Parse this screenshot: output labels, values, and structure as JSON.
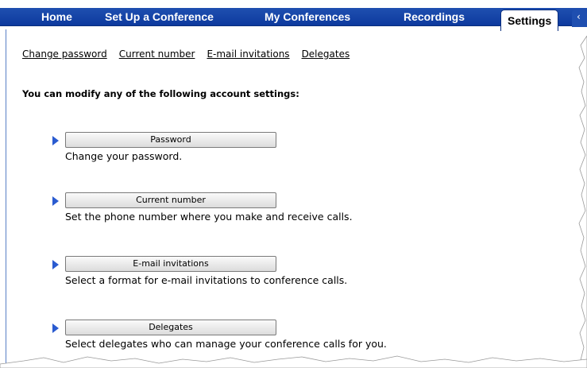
{
  "nav": {
    "tabs": [
      {
        "label": "Home"
      },
      {
        "label": "Set Up a Conference"
      },
      {
        "label": "My Conferences"
      },
      {
        "label": "Recordings"
      },
      {
        "label": "Settings"
      }
    ],
    "partial_tab_glyph": "‹",
    "accent": "#1f4fb0"
  },
  "sublinks": [
    "Change password",
    "Current number",
    "E-mail invitations",
    "Delegates"
  ],
  "intro": "You can modify any of the following account settings:",
  "items": [
    {
      "button": "Password",
      "desc": "Change your password."
    },
    {
      "button": "Current number",
      "desc": "Set the phone number where you make and receive calls."
    },
    {
      "button": "E-mail invitations",
      "desc": "Select a format for e-mail invitations to conference calls."
    },
    {
      "button": "Delegates",
      "desc": "Select delegates who can manage your conference calls for you."
    }
  ]
}
